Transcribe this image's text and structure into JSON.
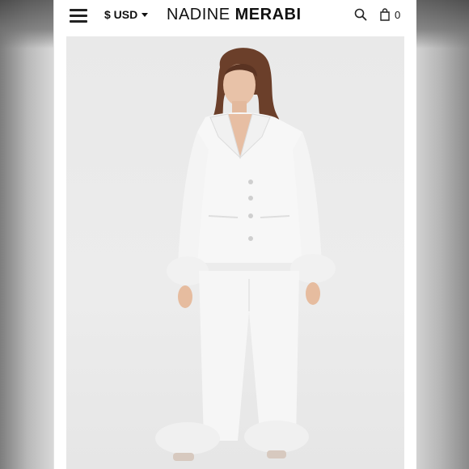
{
  "header": {
    "currency_label": "$ USD",
    "brand_first": "NADINE",
    "brand_second": "MERABI",
    "cart_count": "0",
    "icons": [
      "menu-icon",
      "caret-down-icon",
      "search-icon",
      "shopping-bag-icon"
    ]
  },
  "product": {
    "image_alt": "Model wearing white satin pajama set with feather cuffs"
  },
  "colors": {
    "background": "#ffffff",
    "text": "#111111",
    "garment": "#f7f7f7",
    "feathers": "#f1f1f1",
    "hair": "#6b3f2a"
  }
}
